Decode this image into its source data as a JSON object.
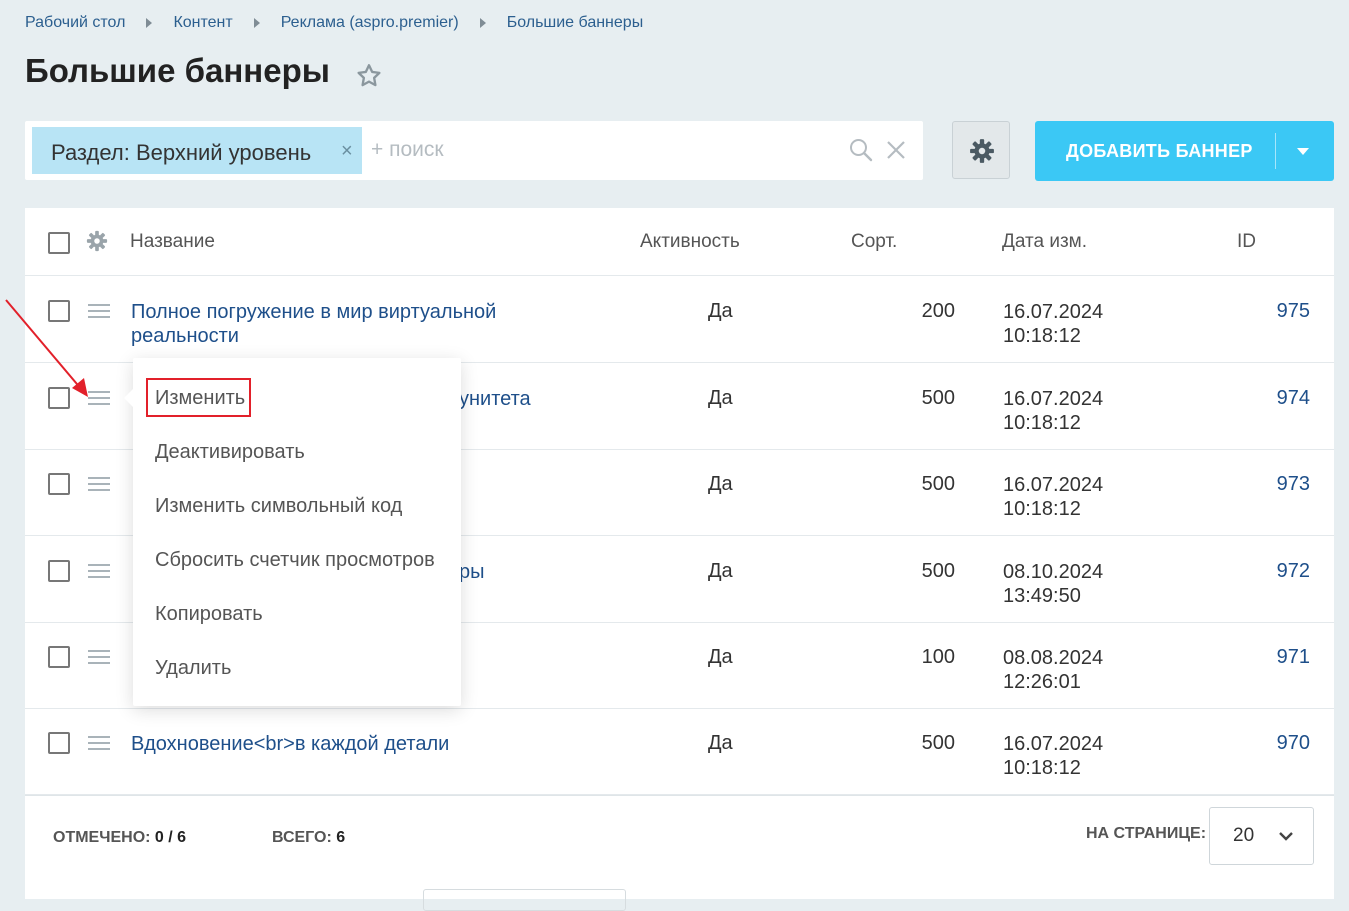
{
  "breadcrumb": [
    "Рабочий стол",
    "Контент",
    "Реклама (aspro.premier)",
    "Большие баннеры"
  ],
  "page_title": "Большие баннеры",
  "filter": {
    "tag_label": "Раздел: Верхний уровень",
    "tag_close": "×",
    "search_placeholder": "+ поиск"
  },
  "add_button": {
    "label": "ДОБАВИТЬ БАННЕР"
  },
  "table": {
    "columns": {
      "name": "Название",
      "active": "Активность",
      "sort": "Сорт.",
      "date": "Дата изм.",
      "id": "ID"
    },
    "rows": [
      {
        "name": "Полное погружение в мир виртуальной реальности",
        "active": "Да",
        "sort": "200",
        "date": "16.07.2024",
        "time": "10:18:12",
        "id": "975"
      },
      {
        "name": "унитета",
        "active": "Да",
        "sort": "500",
        "date": "16.07.2024",
        "time": "10:18:12",
        "id": "974"
      },
      {
        "name": "",
        "active": "Да",
        "sort": "500",
        "date": "16.07.2024",
        "time": "10:18:12",
        "id": "973"
      },
      {
        "name": "ры",
        "active": "Да",
        "sort": "500",
        "date": "08.10.2024",
        "time": "13:49:50",
        "id": "972"
      },
      {
        "name": "",
        "active": "Да",
        "sort": "100",
        "date": "08.08.2024",
        "time": "12:26:01",
        "id": "971"
      },
      {
        "name": "Вдохновение<br>в каждой детали",
        "active": "Да",
        "sort": "500",
        "date": "16.07.2024",
        "time": "10:18:12",
        "id": "970"
      }
    ]
  },
  "footer": {
    "selected_label": "ОТМЕЧЕНО:",
    "selected_value": "0 / 6",
    "total_label": "ВСЕГО:",
    "total_value": "6",
    "per_page_label": "НА СТРАНИЦЕ:",
    "per_page_value": "20"
  },
  "context_menu": {
    "items": [
      "Изменить",
      "Деактивировать",
      "Изменить символьный код",
      "Сбросить счетчик просмотров",
      "Копировать",
      "Удалить"
    ],
    "highlighted": "Изменить"
  },
  "colors": {
    "accent": "#3bc8f5",
    "link": "#1e4f8a",
    "highlight": "#e2202a",
    "filter_tag": "#b8e4f5",
    "background": "#e7eef1"
  },
  "icons": [
    "star-icon",
    "search-icon",
    "close-icon",
    "gear-icon",
    "drag-handle-icon",
    "chevron-down-icon",
    "caret-down-icon"
  ]
}
